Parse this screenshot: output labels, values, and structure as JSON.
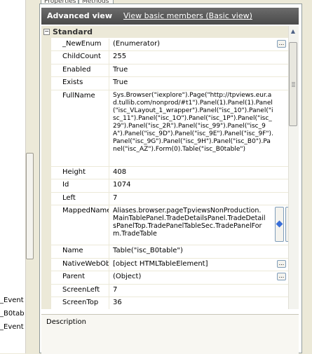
{
  "tabs": [
    "Properties",
    "Methods"
  ],
  "header": {
    "title": "Advanced view",
    "link": "View basic members (Basic view)"
  },
  "left_panel": {
    "lines": [
      "_Event",
      "_B0tab",
      "_Event"
    ]
  },
  "category": {
    "expander": "−",
    "label": "Standard"
  },
  "properties": [
    {
      "name": "_NewEnum",
      "value": "(Enumerator)",
      "has_button": true
    },
    {
      "name": "ChildCount",
      "value": "255"
    },
    {
      "name": "Enabled",
      "value": "True"
    },
    {
      "name": "Exists",
      "value": "True"
    },
    {
      "name": "FullName",
      "value": "Sys.Browser(\"iexplore\").Page(\"http://tpviews.eur.ad.tullib.com/nonprod/#t1\").Panel(1).Panel(1).Panel(\"isc_VLayout_1_wrapper\").Panel(\"isc_10\").Panel(\"isc_11\").Panel(\"isc_1O\").Panel(\"isc_1P\").Panel(\"isc_29\").Panel(\"isc_2R\").Panel(\"isc_99\").Panel(\"isc_9A\").Panel(\"isc_9D\").Panel(\"isc_9E\").Panel(\"isc_9F\").Panel(\"isc_9G\").Panel(\"isc_9H\").Panel(\"isc_B0\").Panel(\"isc_AZ\").Form(0).Table(\"isc_B0table\")"
    },
    {
      "name": "Height",
      "value": "408"
    },
    {
      "name": "Id",
      "value": "1074"
    },
    {
      "name": "Left",
      "value": "7"
    },
    {
      "name": "MappedName",
      "value": "Aliases.browser.pageTpviewsNonProduction.MainTablePanel.TradeDetailsPanel.TradeDetailsPanelTop.TradePanelTableSec.TradePanelForm.TradeTable"
    },
    {
      "name": "Name",
      "value": "Table(\"isc_B0table\")"
    },
    {
      "name": "NativeWebOb:",
      "value": "[object HTMLTableElement]",
      "has_button": true
    },
    {
      "name": "Parent",
      "value": "(Object)",
      "has_button": true
    },
    {
      "name": "ScreenLeft",
      "value": "7"
    },
    {
      "name": "ScreenTop",
      "value": "36"
    }
  ],
  "button_glyph": "...",
  "description": {
    "label": "Description"
  }
}
